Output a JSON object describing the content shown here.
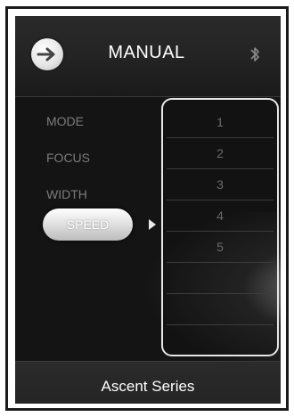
{
  "header": {
    "title": "MANUAL",
    "back_icon": "arrow-right-icon",
    "bluetooth_icon": "bluetooth-icon"
  },
  "menu": {
    "items": [
      {
        "label": "MODE"
      },
      {
        "label": "FOCUS"
      },
      {
        "label": "WIDTH"
      },
      {
        "label": "SPEED",
        "selected": true
      }
    ]
  },
  "list": {
    "rows": [
      "1",
      "2",
      "3",
      "4",
      "5",
      "",
      "",
      ""
    ]
  },
  "footer": {
    "label": "Ascent Series"
  }
}
